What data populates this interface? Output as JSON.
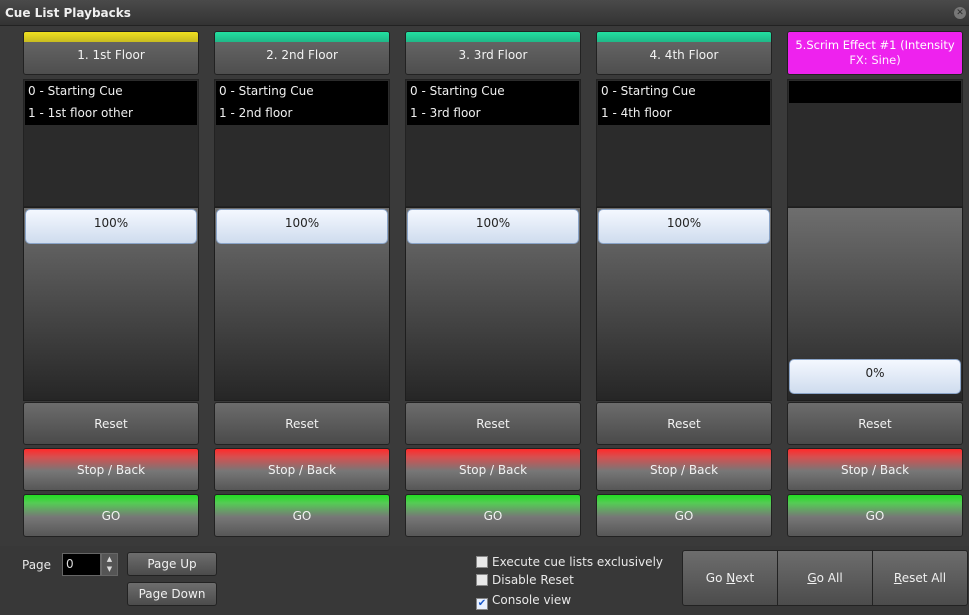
{
  "window": {
    "title": "Cue List Playbacks"
  },
  "playbacks": [
    {
      "header": "1. 1st Floor",
      "color": "#f0e020",
      "cues": [
        "0 - Starting Cue",
        "1 - 1st floor other"
      ],
      "level": "100%",
      "level_fraction": 1.0,
      "reset_label": "Reset",
      "stop_label": "Stop / Back",
      "go_label": "GO"
    },
    {
      "header": "2. 2nd Floor",
      "color": "#22e0a0",
      "cues": [
        "0 - Starting Cue",
        "1 - 2nd floor"
      ],
      "level": "100%",
      "level_fraction": 1.0,
      "reset_label": "Reset",
      "stop_label": "Stop / Back",
      "go_label": "GO"
    },
    {
      "header": "3. 3rd Floor",
      "color": "#22e0a0",
      "cues": [
        "0 - Starting Cue",
        "1 - 3rd floor"
      ],
      "level": "100%",
      "level_fraction": 1.0,
      "reset_label": "Reset",
      "stop_label": "Stop / Back",
      "go_label": "GO"
    },
    {
      "header": "4. 4th Floor",
      "color": "#22e0a0",
      "cues": [
        "0 - Starting Cue",
        "1 - 4th floor"
      ],
      "level": "100%",
      "level_fraction": 1.0,
      "reset_label": "Reset",
      "stop_label": "Stop / Back",
      "go_label": "GO"
    },
    {
      "header_line1": "5.Scrim Effect #1 (Intensity",
      "header_line2": "FX: Sine)",
      "color": "#ee22ee",
      "cues": [],
      "level": "0%",
      "level_fraction": 0.0,
      "reset_label": "Reset",
      "stop_label": "Stop / Back",
      "go_label": "GO"
    }
  ],
  "footer": {
    "page_label": "Page",
    "page_value": "0",
    "page_up": "Page Up",
    "page_down": "Page Down",
    "options": [
      {
        "label": "Execute cue lists exclusively",
        "checked": false
      },
      {
        "label": "Disable Reset",
        "checked": false
      },
      {
        "label": "Console view",
        "checked": true
      }
    ],
    "go_next_pre": "Go ",
    "go_next_u": "N",
    "go_next_post": "ext",
    "go_all_u": "G",
    "go_all_post": "o All",
    "reset_all_u": "R",
    "reset_all_post": "eset All"
  }
}
